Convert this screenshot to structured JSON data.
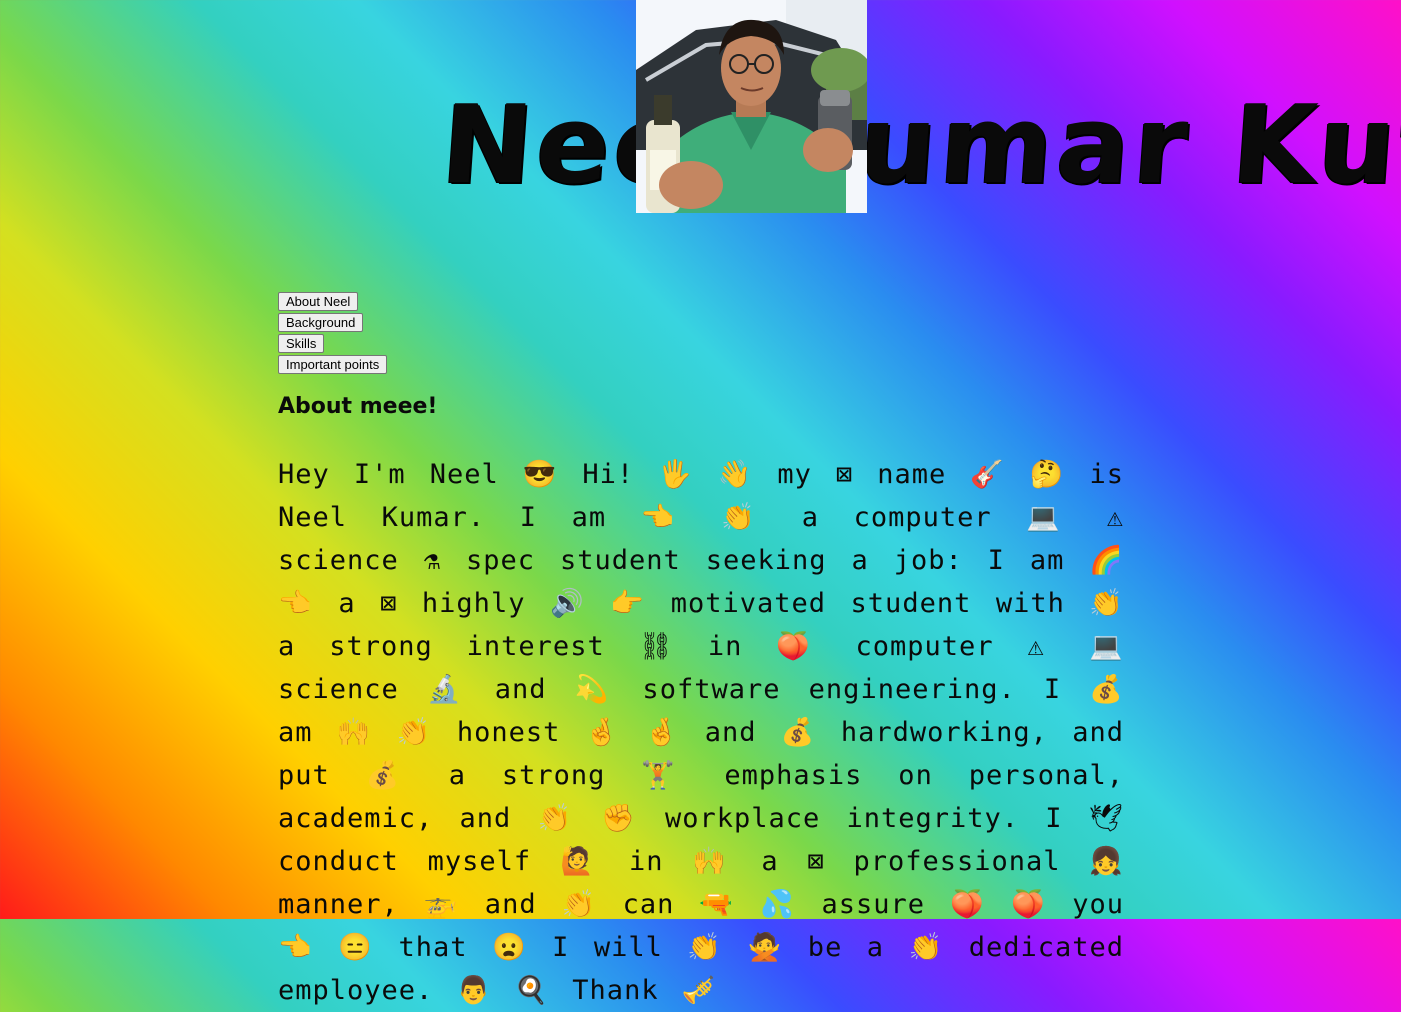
{
  "header": {
    "title": "Neel Kumar Kute",
    "photo_alt": "Neel photo"
  },
  "nav": {
    "about": "About Neel",
    "background": "Background",
    "skills": "Skills",
    "important": "Important points"
  },
  "about": {
    "heading": "About meee!",
    "text": "Hey I'm Neel 😎 Hi! 🖐 👋 my ⊠ name 🎸 🤔 is Neel Kumar. I am 👈 👏 a computer 💻 ⚠ science ⚗ spec student seeking a job: I am 🌈 👈 a ⊠ highly 🔊 👉 motivated student with 👏 a strong interest ⛓ in 🍑 computer ⚠ 💻 science 🔬 and 💫 software engineering. I 💰 am 🙌 👏 honest 🤞 🤞 and 💰 hardworking, and put 💰 a strong 🏋 emphasis on personal, academic, and 👏 ✊ workplace integrity. I 🕊 conduct myself 🙋 in 🙌 a ⊠ professional 👧 manner, 🚁 and 👏 can 🔫 💦 assure 🍑 🍑 you 👈 😑 that 😦 I will 👏 🙅 be a 👏 dedicated employee. 👨 🍳 Thank 🎺"
  }
}
